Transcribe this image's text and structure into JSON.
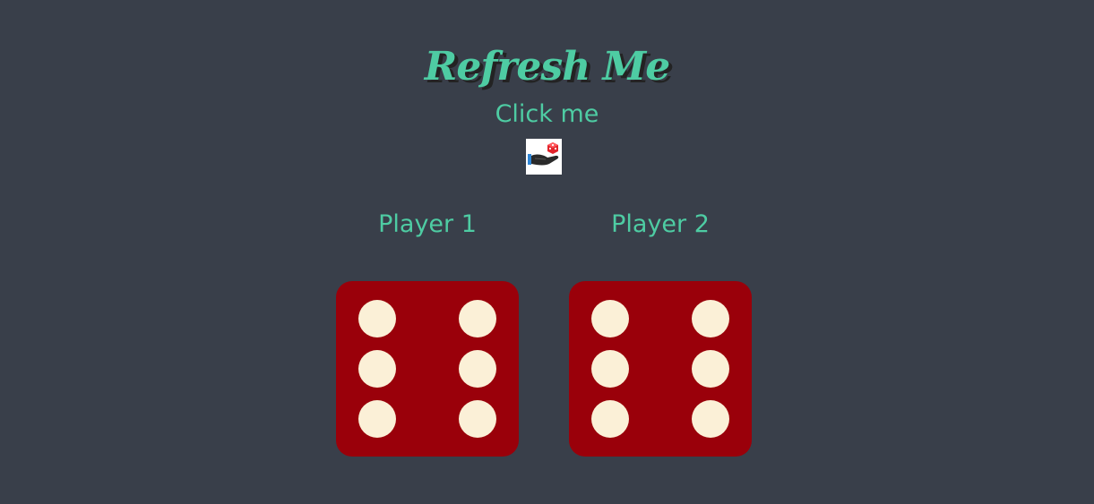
{
  "header": {
    "title": "Refresh Me",
    "click_label": "Click me",
    "roll_button_icon": "hand-with-dice-icon"
  },
  "players": [
    {
      "label": "Player 1",
      "die_value": 6
    },
    {
      "label": "Player 2",
      "die_value": 6
    }
  ],
  "colors": {
    "background": "#393f4a",
    "accent": "#4ecca3",
    "die_face": "#9a000a",
    "pip": "#fbf0d7"
  }
}
